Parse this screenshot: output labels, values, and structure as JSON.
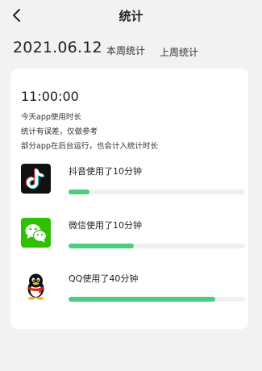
{
  "header": {
    "title": "统计"
  },
  "date": "2021.06.12",
  "tabs": {
    "this_week": "本周统计",
    "last_week": "上周统计"
  },
  "summary": {
    "total_time": "11:00:00",
    "notes": [
      "今天app使用时长",
      "统计有误差，仅做参考",
      "部分app在后台运行，也会计入统计时长"
    ]
  },
  "apps": [
    {
      "icon": "douyin-icon",
      "label": "抖音使用了10分钟",
      "usage_fraction": 0.12
    },
    {
      "icon": "wechat-icon",
      "label": "微信使用了10分钟",
      "usage_fraction": 0.37
    },
    {
      "icon": "qq-icon",
      "label": "QQ使用了40分钟",
      "usage_fraction": 0.83
    }
  ],
  "colors": {
    "background": "#f2f2f2",
    "card": "#ffffff",
    "bar_fill": "#4ccc83",
    "bar_track": "#f0f0f0",
    "wechat_green": "#2dc100",
    "douyin_bg": "#111111"
  }
}
